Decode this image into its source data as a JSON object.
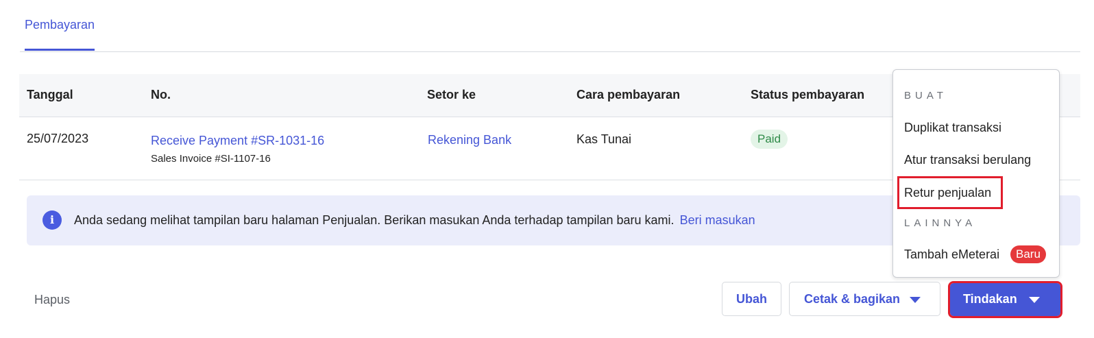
{
  "tabs": {
    "active_label": "Pembayaran"
  },
  "table": {
    "headers": {
      "date": "Tanggal",
      "number": "No.",
      "deposit_to": "Setor ke",
      "payment_method": "Cara pembayaran",
      "status": "Status pembayaran"
    },
    "rows": [
      {
        "date": "25/07/2023",
        "number": "Receive Payment #SR-1031-16",
        "reference": "Sales Invoice #SI-1107-16",
        "deposit_to": "Rekening Bank",
        "payment_method": "Kas Tunai",
        "status": "Paid"
      }
    ]
  },
  "banner": {
    "icon": "info-icon",
    "text": "Anda sedang melihat tampilan baru halaman Penjualan. Berikan masukan Anda terhadap tampilan baru kami.",
    "link": "Beri masukan"
  },
  "footer": {
    "delete_label": "Hapus",
    "edit_label": "Ubah",
    "print_share_label": "Cetak & bagikan",
    "actions_label": "Tindakan"
  },
  "actions_menu": {
    "section_create": "BUAT",
    "items_create": [
      "Duplikat transaksi",
      "Atur transaksi berulang",
      "Retur penjualan"
    ],
    "section_other": "LAINNYA",
    "items_other": [
      "Tambah eMeterai"
    ],
    "new_badge": "Baru"
  },
  "colors": {
    "accent": "#4556d6",
    "highlight": "#e11d2c",
    "paid_bg": "#e3f4e7",
    "paid_text": "#2f8a48"
  }
}
